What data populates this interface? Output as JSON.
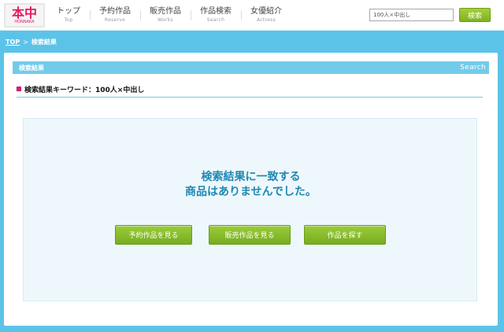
{
  "header": {
    "logo": {
      "main": "本中",
      "sub": "HONNAKA"
    },
    "nav": [
      {
        "label": "トップ",
        "sub": "Top"
      },
      {
        "label": "予約作品",
        "sub": "Reserve"
      },
      {
        "label": "販売作品",
        "sub": "Works"
      },
      {
        "label": "作品検索",
        "sub": "Search"
      },
      {
        "label": "女優紹介",
        "sub": "Actress"
      }
    ],
    "search": {
      "value": "100人×中出し",
      "button_label": "検索"
    }
  },
  "breadcrumb": {
    "home": "TOP",
    "separator": ">",
    "current": "検索結果"
  },
  "panel": {
    "title": "検索結果",
    "title_en": "Search",
    "keyword_label": "検索結果キーワード：100人×中出し"
  },
  "result": {
    "message_line1": "検索結果に一致する",
    "message_line2": "商品はありませんでした。",
    "buttons": {
      "reserve": "予約作品を見る",
      "works": "販売作品を見る",
      "search": "作品を探す"
    }
  },
  "colors": {
    "background": "#5cc3e8",
    "accent_green": "#85bb25",
    "logo_pink": "#e8195c",
    "message_blue": "#1f88b3"
  }
}
